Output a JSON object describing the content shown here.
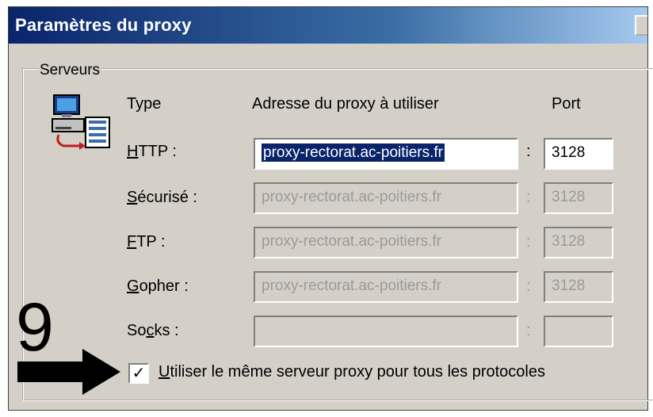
{
  "window": {
    "title": "Paramètres du proxy"
  },
  "servers_group": {
    "legend": "Serveurs",
    "icon": "network-computers-icon",
    "headers": {
      "type": "Type",
      "address": "Adresse du proxy à utiliser",
      "port": "Port"
    },
    "rows": [
      {
        "label_pre": "",
        "label_u": "H",
        "label_post": "TTP :",
        "address": "proxy-rectorat.ac-poitiers.fr",
        "port": "3128",
        "enabled": true,
        "selected": true
      },
      {
        "label_pre": "",
        "label_u": "S",
        "label_post": "écurisé :",
        "address": "proxy-rectorat.ac-poitiers.fr",
        "port": "3128",
        "enabled": false
      },
      {
        "label_pre": "",
        "label_u": "F",
        "label_post": "TP :",
        "address": "proxy-rectorat.ac-poitiers.fr",
        "port": "3128",
        "enabled": false
      },
      {
        "label_pre": "",
        "label_u": "G",
        "label_post": "opher :",
        "address": "proxy-rectorat.ac-poitiers.fr",
        "port": "3128",
        "enabled": false
      },
      {
        "label_pre": "So",
        "label_u": "c",
        "label_post": "ks :",
        "address": "",
        "port": "",
        "enabled": false
      }
    ],
    "separator": ":"
  },
  "same_proxy_checkbox": {
    "checked": true,
    "mark": "✓",
    "label_u": "U",
    "label_rest": "tiliser le même serveur proxy pour tous les protocoles"
  },
  "annotation": {
    "number": "9",
    "arrow_icon": "right-arrow-icon",
    "color": "#000000"
  },
  "colors": {
    "titlebar_start": "#0a246a",
    "titlebar_end": "#a6caf0",
    "dialog_bg": "#d4d0c8",
    "selection_bg": "#0a246a"
  }
}
